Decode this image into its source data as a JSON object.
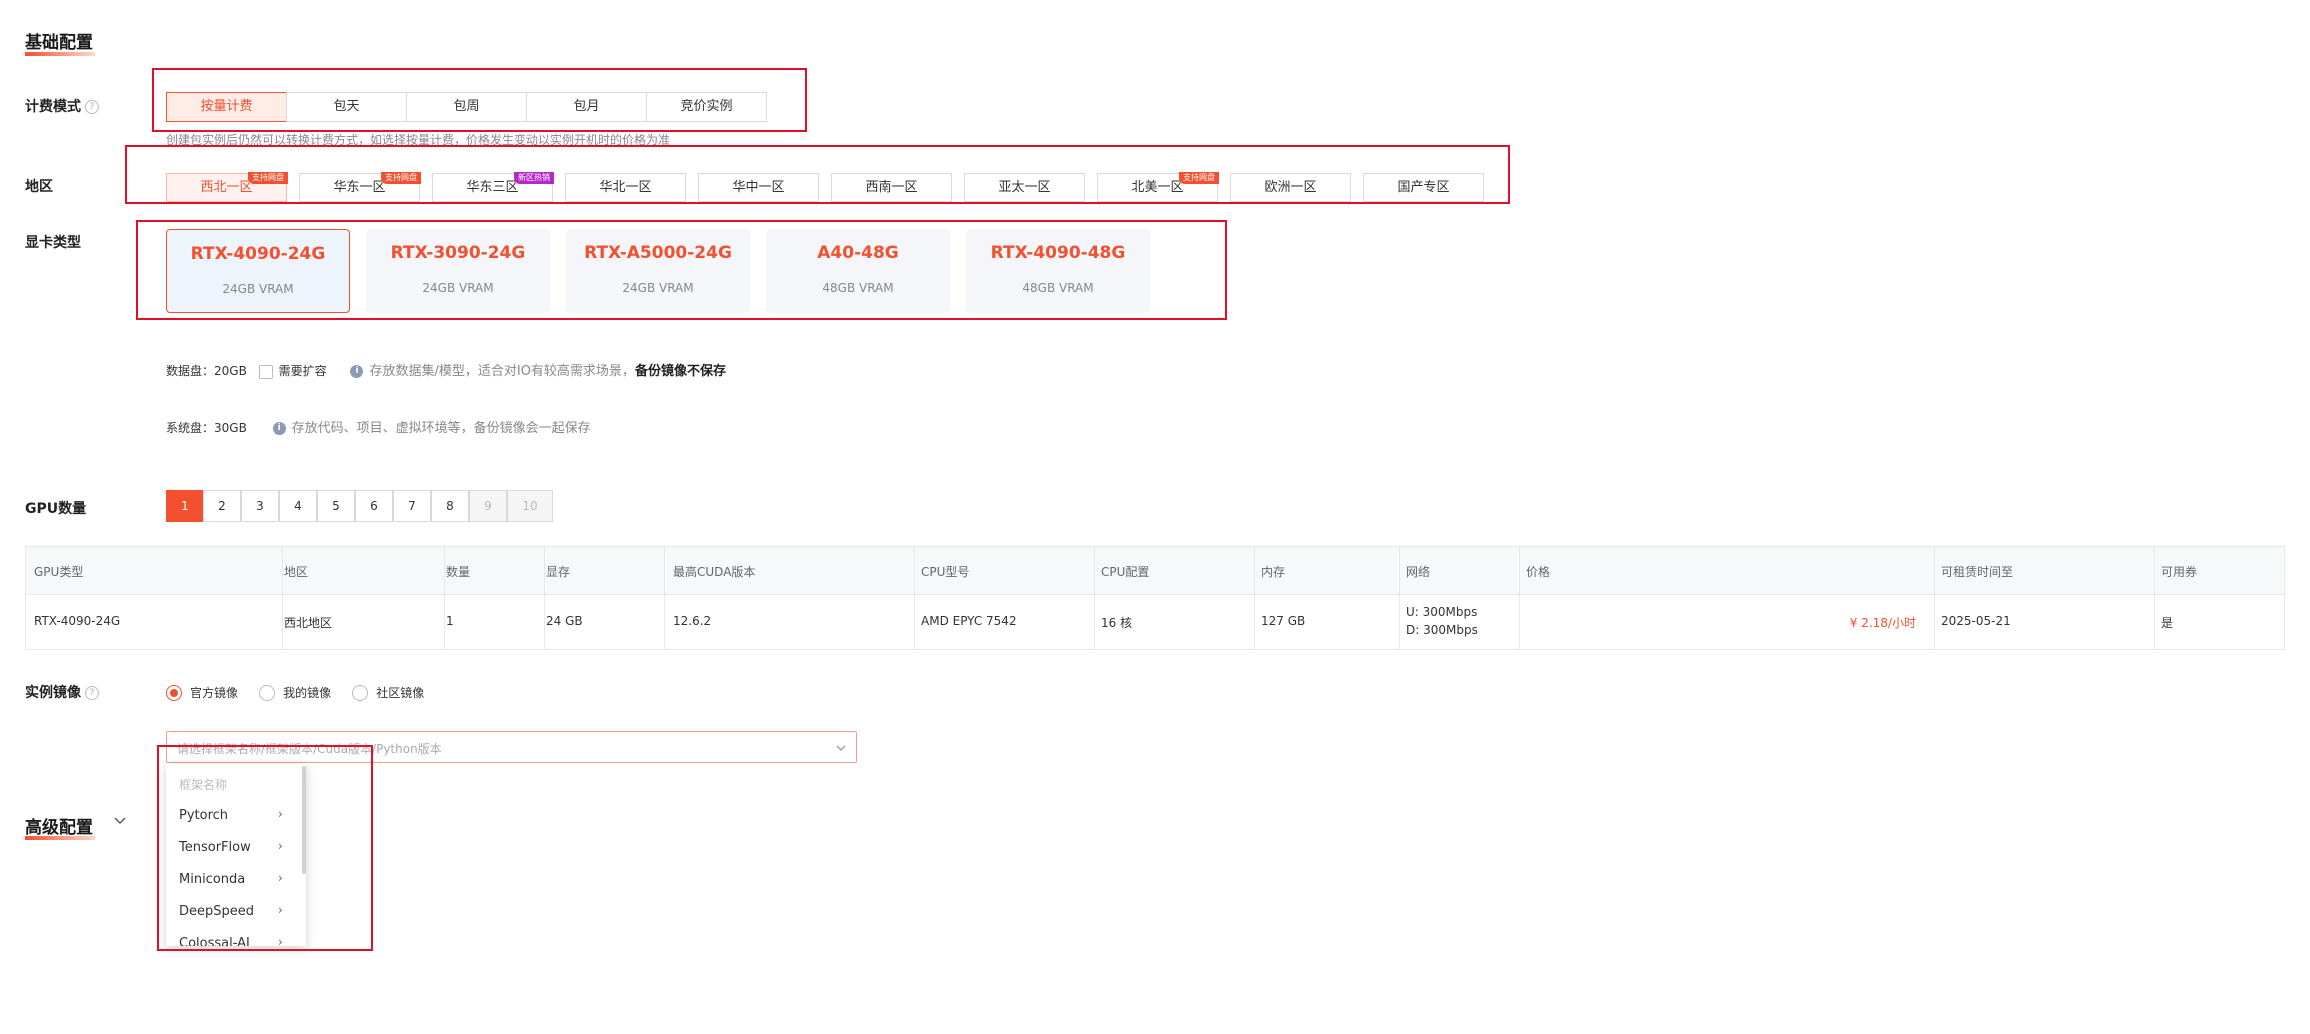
{
  "basic": {
    "title": "基础配置"
  },
  "billing": {
    "label": "计费模式",
    "options": [
      "按量计费",
      "包天",
      "包周",
      "包月",
      "竞价实例"
    ],
    "note": "创建包实例后仍然可以转换计费方式，如选择按量计费，价格发生变动以实例开机时的价格为准"
  },
  "region": {
    "label": "地区",
    "options": [
      {
        "name": "西北一区",
        "tag": "支持网盘"
      },
      {
        "name": "华东一区",
        "tag": "支持网盘"
      },
      {
        "name": "华东三区",
        "tag": "新区热销"
      },
      {
        "name": "华北一区",
        "tag": ""
      },
      {
        "name": "华中一区",
        "tag": ""
      },
      {
        "name": "西南一区",
        "tag": ""
      },
      {
        "name": "亚太一区",
        "tag": ""
      },
      {
        "name": "北美一区",
        "tag": "支持网盘"
      },
      {
        "name": "欧洲一区",
        "tag": ""
      },
      {
        "name": "国产专区",
        "tag": ""
      }
    ]
  },
  "gpu_type": {
    "label": "显卡类型",
    "cards": [
      {
        "name": "RTX-4090-24G",
        "vram": "24GB VRAM"
      },
      {
        "name": "RTX-3090-24G",
        "vram": "24GB VRAM"
      },
      {
        "name": "RTX-A5000-24G",
        "vram": "24GB VRAM"
      },
      {
        "name": "A40-48G",
        "vram": "48GB VRAM"
      },
      {
        "name": "RTX-4090-48G",
        "vram": "48GB VRAM"
      }
    ]
  },
  "data_disk": {
    "label": "数据盘：20GB",
    "expand": "需要扩容",
    "note": "存放数据集/模型，适合对IO有较高需求场景，",
    "note_bold": "备份镜像不保存"
  },
  "sys_disk": {
    "label": "系统盘：30GB",
    "note": "存放代码、项目、虚拟环境等，备份镜像会一起保存"
  },
  "gpu_count": {
    "label": "GPU数量",
    "options": [
      "1",
      "2",
      "3",
      "4",
      "5",
      "6",
      "7",
      "8",
      "9",
      "10"
    ]
  },
  "table": {
    "headers": [
      "GPU类型",
      "地区",
      "数量",
      "显存",
      "最高CUDA版本",
      "CPU型号",
      "CPU配置",
      "内存",
      "网络",
      "价格",
      "可租赁时间至",
      "可用券"
    ],
    "row": {
      "gpu": "RTX-4090-24G",
      "region": "西北地区",
      "count": "1",
      "vram": "24 GB",
      "cuda": "12.6.2",
      "cpu_model": "AMD EPYC 7542",
      "cpu_cfg": "16 核",
      "memory": "127 GB",
      "net_up": "U: 300Mbps",
      "net_down": "D: 300Mbps",
      "price": "¥ 2.18",
      "price_unit": "/小时",
      "until": "2025-05-21",
      "coupon": "是"
    }
  },
  "image": {
    "label": "实例镜像",
    "options": [
      "官方镜像",
      "我的镜像",
      "社区镜像"
    ],
    "placeholder": "请选择框架名称/框架版本/Cuda版本/Python版本",
    "dropdown_header": "框架名称",
    "frameworks": [
      "Pytorch",
      "TensorFlow",
      "Miniconda",
      "DeepSpeed",
      "Colossal-AI"
    ]
  },
  "advanced": {
    "title": "高级配置"
  },
  "colors": {
    "accent": "#f2502e",
    "highlight_box": "#e0102a"
  }
}
